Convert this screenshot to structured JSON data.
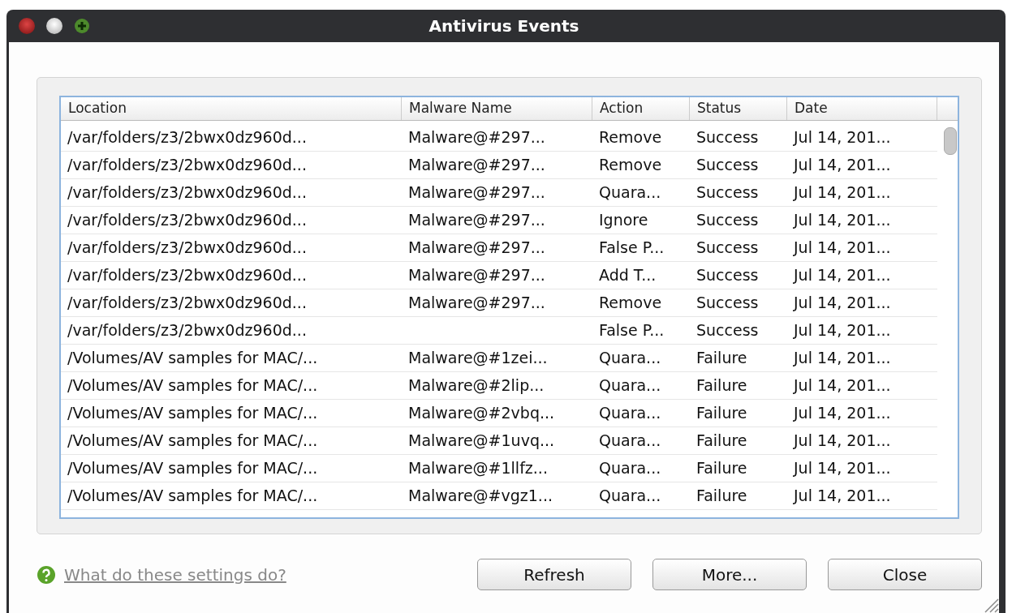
{
  "window": {
    "title": "Antivirus Events"
  },
  "table": {
    "columns": [
      "Location",
      "Malware Name",
      "Action",
      "Status",
      "Date"
    ],
    "rows": [
      [
        "/var/folders/z3/2bwx0dz960d...",
        "Malware@#297...",
        "Remove",
        "Success",
        "Jul 14, 201..."
      ],
      [
        "/var/folders/z3/2bwx0dz960d...",
        "Malware@#297...",
        "Remove",
        "Success",
        "Jul 14, 201..."
      ],
      [
        "/var/folders/z3/2bwx0dz960d...",
        "Malware@#297...",
        "Quara...",
        "Success",
        "Jul 14, 201..."
      ],
      [
        "/var/folders/z3/2bwx0dz960d...",
        "Malware@#297...",
        "Ignore",
        "Success",
        "Jul 14, 201..."
      ],
      [
        "/var/folders/z3/2bwx0dz960d...",
        "Malware@#297...",
        "False P...",
        "Success",
        "Jul 14, 201..."
      ],
      [
        "/var/folders/z3/2bwx0dz960d...",
        "Malware@#297...",
        "Add T...",
        "Success",
        "Jul 14, 201..."
      ],
      [
        "/var/folders/z3/2bwx0dz960d...",
        "Malware@#297...",
        "Remove",
        "Success",
        "Jul 14, 201..."
      ],
      [
        "/var/folders/z3/2bwx0dz960d...",
        "",
        "False P...",
        "Success",
        "Jul 14, 201..."
      ],
      [
        "/Volumes/AV samples for MAC/...",
        "Malware@#1zei...",
        "Quara...",
        "Failure",
        "Jul 14, 201..."
      ],
      [
        "/Volumes/AV samples for MAC/...",
        "Malware@#2lip...",
        "Quara...",
        "Failure",
        "Jul 14, 201..."
      ],
      [
        "/Volumes/AV samples for MAC/...",
        "Malware@#2vbq...",
        "Quara...",
        "Failure",
        "Jul 14, 201..."
      ],
      [
        "/Volumes/AV samples for MAC/...",
        "Malware@#1uvq...",
        "Quara...",
        "Failure",
        "Jul 14, 201..."
      ],
      [
        "/Volumes/AV samples for MAC/...",
        "Malware@#1llfz...",
        "Quara...",
        "Failure",
        "Jul 14, 201..."
      ],
      [
        "/Volumes/AV samples for MAC/...",
        "Malware@#vgz1...",
        "Quara...",
        "Failure",
        "Jul 14, 201..."
      ]
    ]
  },
  "help_link": "What do these settings do?",
  "buttons": [
    "Refresh",
    "More...",
    "Close"
  ]
}
